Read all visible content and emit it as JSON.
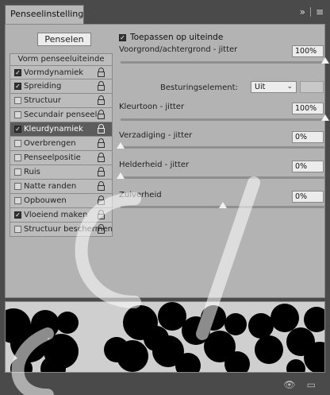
{
  "tab": {
    "title": "Penseelinstellingen"
  },
  "tab_menu": {
    "collapse_glyph": "»",
    "menu_glyph": "≡"
  },
  "brush_presets_button": {
    "label": "Penselen"
  },
  "list": {
    "header": "Vorm penseeluiteinde",
    "items": [
      {
        "label": "Vormdynamiek",
        "checked": true,
        "selected": false
      },
      {
        "label": "Spreiding",
        "checked": true,
        "selected": false
      },
      {
        "label": "Structuur",
        "checked": false,
        "selected": false
      },
      {
        "label": "Secundair penseel",
        "checked": false,
        "selected": false
      },
      {
        "label": "Kleurdynamiek",
        "checked": true,
        "selected": true
      },
      {
        "label": "Overbrengen",
        "checked": false,
        "selected": false
      },
      {
        "label": "Penseelpositie",
        "checked": false,
        "selected": false
      },
      {
        "label": "Ruis",
        "checked": false,
        "selected": false
      },
      {
        "label": "Natte randen",
        "checked": false,
        "selected": false
      },
      {
        "label": "Opbouwen",
        "checked": false,
        "selected": false
      },
      {
        "label": "Vloeiend maken",
        "checked": true,
        "selected": false
      },
      {
        "label": "Structuur beschermen",
        "checked": false,
        "selected": false
      }
    ]
  },
  "apply_per_tip": {
    "label": "Toepassen op uiteinde",
    "checked": true
  },
  "fg_bg_jitter": {
    "label": "Voorgrond/achtergrond - jitter",
    "value": "100%",
    "level": 1.0
  },
  "control": {
    "label": "Besturingselement:",
    "value": "Uit"
  },
  "hue_jitter": {
    "label": "Kleurtoon - jitter",
    "value": "100%",
    "level": 1.0
  },
  "saturation_jitter": {
    "label": "Verzadiging - jitter",
    "value": "0%",
    "level": 0.0
  },
  "brightness_jitter": {
    "label": "Helderheid - jitter",
    "value": "0%",
    "level": 0.0
  },
  "purity": {
    "label": "Zuiverheid",
    "value": "0%",
    "level": 0.5
  },
  "footer": {
    "icon_1": "eye-brush-icon",
    "icon_2": "new-preset-icon"
  }
}
